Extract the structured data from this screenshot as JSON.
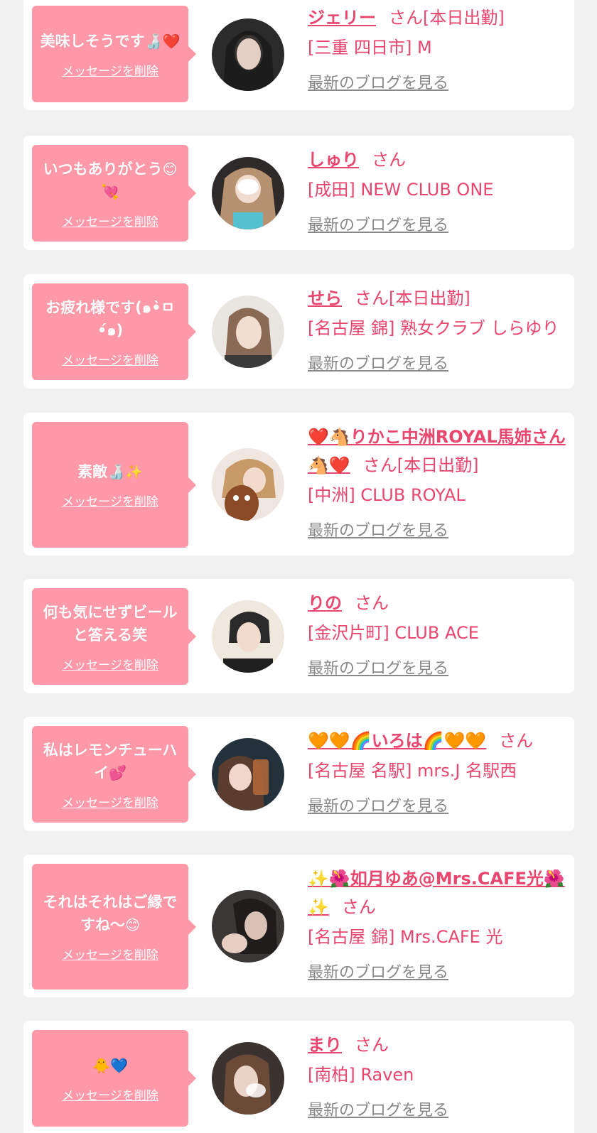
{
  "delete_label": "メッセージを削除",
  "blog_label": "最新のブログを見る",
  "colors": {
    "bubble": "#ff98a8",
    "accent": "#e8466e",
    "background": "#f1f1f1"
  },
  "items": [
    {
      "message": "美味しそうです",
      "message_emoji": "🍶❤️",
      "name": "ジェリー",
      "suffix": "さん[本日出勤]",
      "shop": "[三重 四日市] M"
    },
    {
      "message": "いつもありがとう",
      "message_emoji": "😊💘",
      "name": "しゅり",
      "suffix": "さん",
      "shop": "[成田] NEW CLUB ONE"
    },
    {
      "message": "お疲れ様です(๑•̀ㅁ•́๑)",
      "message_emoji": "",
      "name": "せら",
      "suffix": "さん[本日出勤]",
      "shop": "[名古屋 錦] 熟女クラブ しらゆり"
    },
    {
      "message": "素敵",
      "message_emoji": "🍶✨",
      "name": "❤️🐴りかこ中洲ROYAL馬姉さん🐴❤️",
      "suffix": "さん[本日出勤]",
      "shop": "[中洲] CLUB ROYAL"
    },
    {
      "message": "何も気にせずビールと答える笑",
      "message_emoji": "",
      "name": "りの",
      "suffix": "さん",
      "shop": "[金沢片町] CLUB ACE"
    },
    {
      "message": "私はレモンチューハイ",
      "message_emoji": "💕",
      "name": "🧡🧡🌈いろは🌈🧡🧡",
      "suffix": "さん",
      "shop": "[名古屋 名駅] mrs.J 名駅西"
    },
    {
      "message": "それはそれはご縁ですね〜",
      "message_emoji": "😊",
      "name": "✨🌺如月ゆあ@Mrs.CAFE光🌺✨",
      "suffix": "さん",
      "shop": "[名古屋 錦] Mrs.CAFE 光"
    },
    {
      "message": "",
      "message_emoji": "🐥💙",
      "name": "まり",
      "suffix": "さん",
      "shop": "[南柏] Raven"
    }
  ]
}
